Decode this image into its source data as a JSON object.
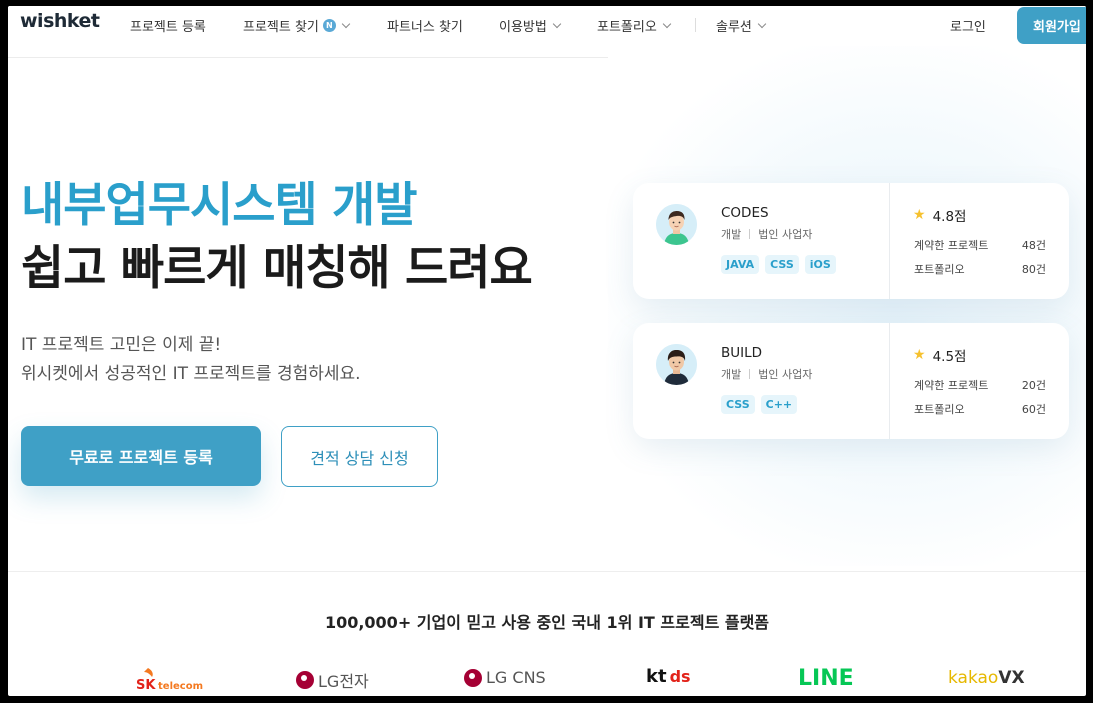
{
  "header": {
    "logo": "wishket",
    "nav": [
      {
        "label": "프로젝트 등록",
        "dropdown": false,
        "badge": ""
      },
      {
        "label": "프로젝트 찾기",
        "dropdown": true,
        "badge": "N"
      },
      {
        "label": "파트너스 찾기",
        "dropdown": false,
        "badge": ""
      },
      {
        "label": "이용방법",
        "dropdown": true,
        "badge": ""
      },
      {
        "label": "포트폴리오",
        "dropdown": true,
        "badge": ""
      },
      {
        "label": "솔루션",
        "dropdown": true,
        "badge": ""
      }
    ],
    "login": "로그인",
    "signup": "회원가입"
  },
  "hero": {
    "title_line1": "내부업무시스템 개발",
    "title_line2": "쉽고 빠르게 매칭해 드려요",
    "subtitle_line1": "IT 프로젝트 고민은 이제 끝!",
    "subtitle_line2": "위시켓에서 성공적인 IT 프로젝트를 경험하세요.",
    "primary_button": "무료로 프로젝트 등록",
    "secondary_button": "견적 상담 신청"
  },
  "cards": [
    {
      "company": "CODES",
      "role": "개발",
      "type": "법인 사업자",
      "tags": [
        "JAVA",
        "CSS",
        "iOS"
      ],
      "rating": "4.8점",
      "contracts_label": "계약한 프로젝트",
      "contracts_value": "48건",
      "portfolio_label": "포트폴리오",
      "portfolio_value": "80건"
    },
    {
      "company": "BUILD",
      "role": "개발",
      "type": "법인 사업자",
      "tags": [
        "CSS",
        "C++"
      ],
      "rating": "4.5점",
      "contracts_label": "계약한 프로젝트",
      "contracts_value": "20건",
      "portfolio_label": "포트폴리오",
      "portfolio_value": "60건"
    }
  ],
  "trusted": {
    "heading": "100,000+ 기업이 믿고 사용 중인 국내 1위 IT 프로젝트 플랫폼",
    "logos": [
      "SK telecom",
      "LG전자",
      "LG CNS",
      "kt ds",
      "LINE",
      "kakaoVX"
    ]
  },
  "colors": {
    "accent": "#3fa0c6",
    "title_accent": "#2a9fcb",
    "star": "#f6c12e"
  }
}
